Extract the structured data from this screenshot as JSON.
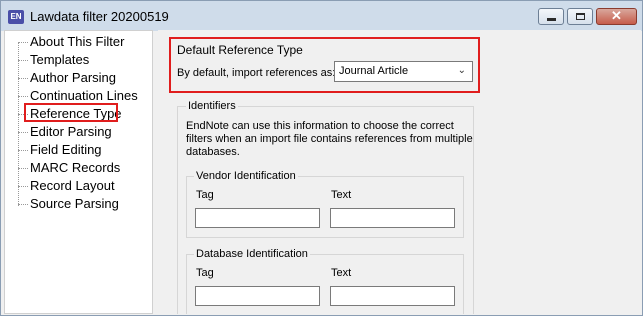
{
  "window": {
    "title": "Lawdata filter 20200519",
    "icon_text": "EN"
  },
  "tree": {
    "items": [
      "About This Filter",
      "Templates",
      "Author Parsing",
      "Continuation Lines",
      "Reference Type",
      "Editor Parsing",
      "Field Editing",
      "MARC Records",
      "Record Layout",
      "Source Parsing"
    ],
    "selected": "Reference Type"
  },
  "reference_type": {
    "group_title": "Default Reference Type",
    "import_label": "By default, import references as:",
    "selected_value": "Journal Article"
  },
  "identifiers": {
    "group_title": "Identifiers",
    "description": "EndNote can use this information to choose the correct filters when an import file contains references from multiple databases.",
    "vendor": {
      "title": "Vendor Identification",
      "tag_label": "Tag",
      "text_label": "Text",
      "tag_value": "",
      "text_value": ""
    },
    "database": {
      "title": "Database Identification",
      "tag_label": "Tag",
      "text_label": "Text",
      "tag_value": "",
      "text_value": ""
    }
  }
}
